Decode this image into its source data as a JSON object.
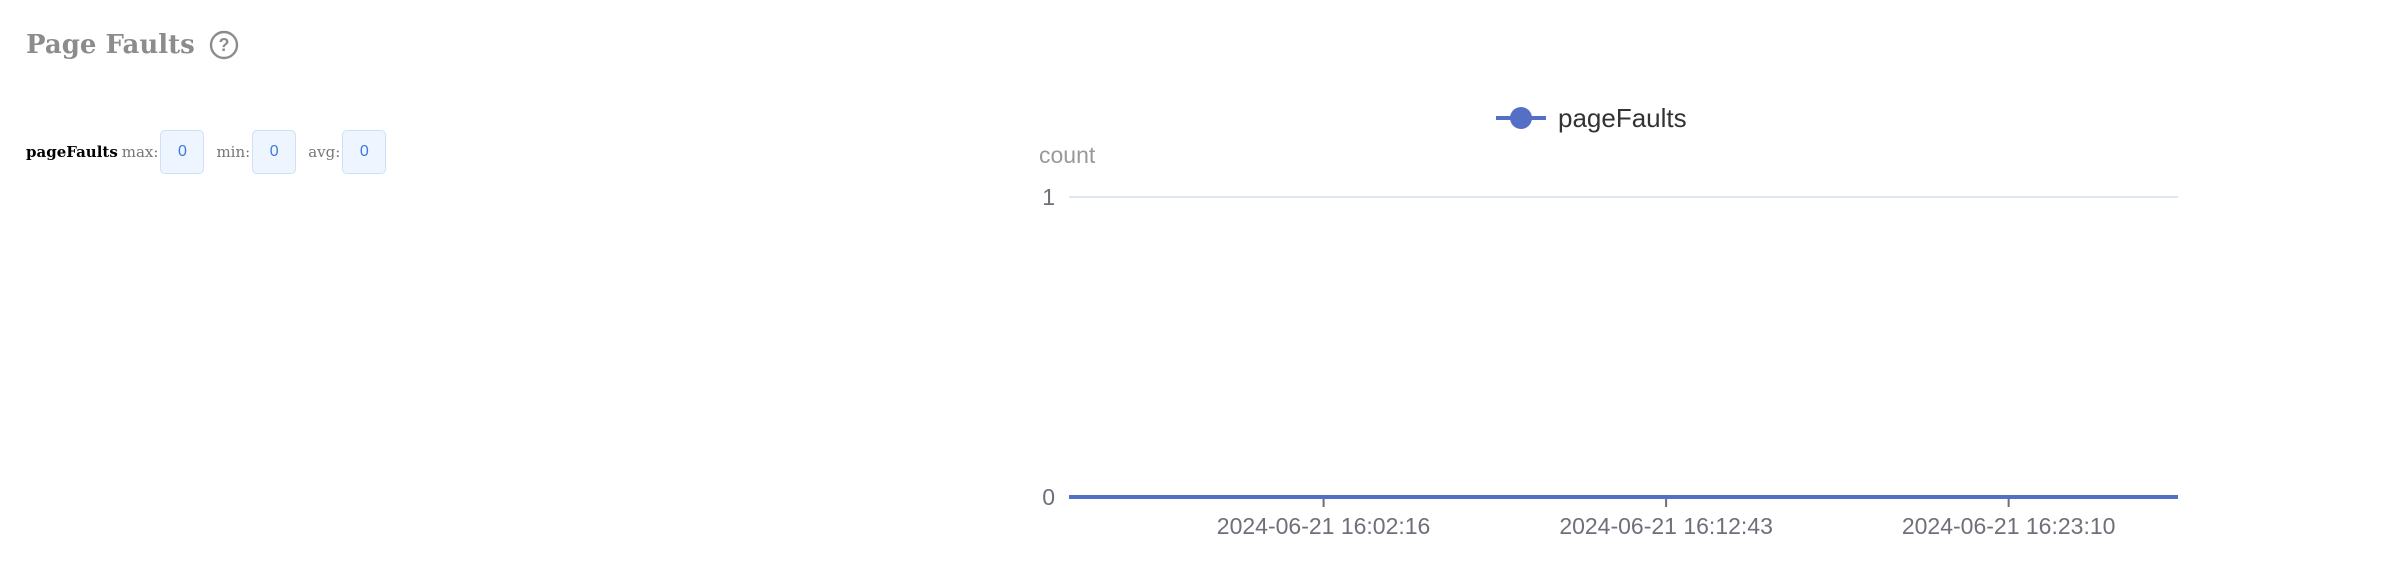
{
  "header": {
    "title": "Page Faults",
    "help_icon": "question-circle-icon"
  },
  "stats": {
    "metric": "pageFaults",
    "items": [
      {
        "label": "max:",
        "value": "0"
      },
      {
        "label": "min:",
        "value": "0"
      },
      {
        "label": "avg:",
        "value": "0"
      }
    ]
  },
  "colors": {
    "series": "#5470c6",
    "grid": "#e0e6f1",
    "axis_text": "#6e7079"
  },
  "chart_data": {
    "type": "line",
    "legend": {
      "entries": [
        "pageFaults"
      ],
      "position": "top-center"
    },
    "ylabel": "count",
    "ylim": [
      0,
      1
    ],
    "yticks": [
      "0",
      "1"
    ],
    "xticks": [
      "2024-06-21 16:02:16",
      "2024-06-21 16:12:43",
      "2024-06-21 16:23:10"
    ],
    "grid": true,
    "series": [
      {
        "name": "pageFaults",
        "x": [
          "2024-06-21 15:54:30",
          "2024-06-21 16:02:16",
          "2024-06-21 16:12:43",
          "2024-06-21 16:23:10",
          "2024-06-21 16:28:20"
        ],
        "values": [
          0,
          0,
          0,
          0,
          0
        ]
      }
    ]
  }
}
